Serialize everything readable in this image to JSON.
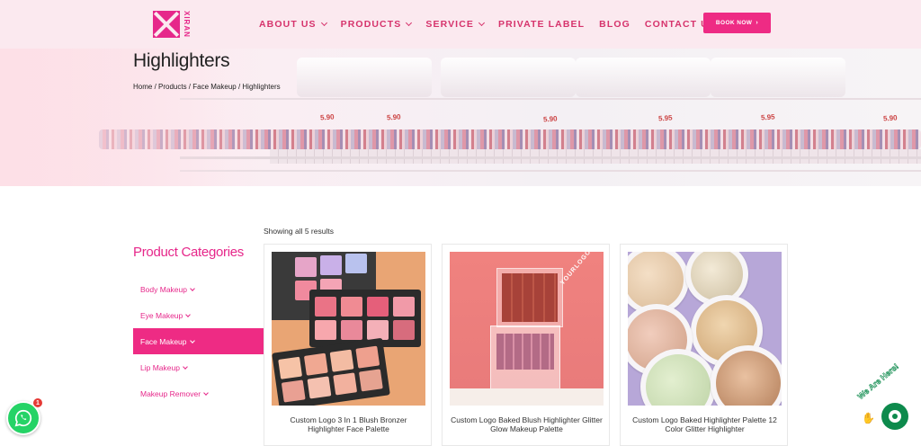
{
  "header": {
    "logo_text": "XIRAN",
    "nav": [
      {
        "label": "ABOUT US",
        "dropdown": true
      },
      {
        "label": "PRODUCTS",
        "dropdown": true
      },
      {
        "label": "SERVICE",
        "dropdown": true
      },
      {
        "label": "PRIVATE LABEL",
        "dropdown": false
      },
      {
        "label": "BLOG",
        "dropdown": false
      },
      {
        "label": "CONTACT US",
        "dropdown": false
      }
    ],
    "book_button": "BOOK NOW",
    "accent_color": "#ee2b84"
  },
  "hero": {
    "title": "Highlighters",
    "breadcrumb": "Home / Products / Face Makeup / Highlighters",
    "price_tags": [
      "5.90",
      "5.90",
      "5.90",
      "5.95",
      "5.95",
      "5.90"
    ]
  },
  "shop": {
    "results_text": "Showing all 5 results",
    "categories_title": "Product Categories",
    "categories": [
      {
        "label": "Body Makeup",
        "active": false
      },
      {
        "label": "Eye Makeup",
        "active": false
      },
      {
        "label": "Face Makeup",
        "active": true
      },
      {
        "label": "Lip Makeup",
        "active": false
      },
      {
        "label": "Makeup Remover",
        "active": false
      }
    ],
    "products": [
      {
        "name": "Custom Logo 3 In 1 Blush Bronzer Highlighter Face Palette"
      },
      {
        "name": "Custom Logo Baked Blush Highlighter Glitter Glow Makeup Palette"
      },
      {
        "name": "Custom Logo Baked Highlighter Palette 12 Color Glitter Highlighter"
      }
    ]
  },
  "widgets": {
    "whatsapp_badge": "1",
    "chat_label": "We Are Here!"
  }
}
